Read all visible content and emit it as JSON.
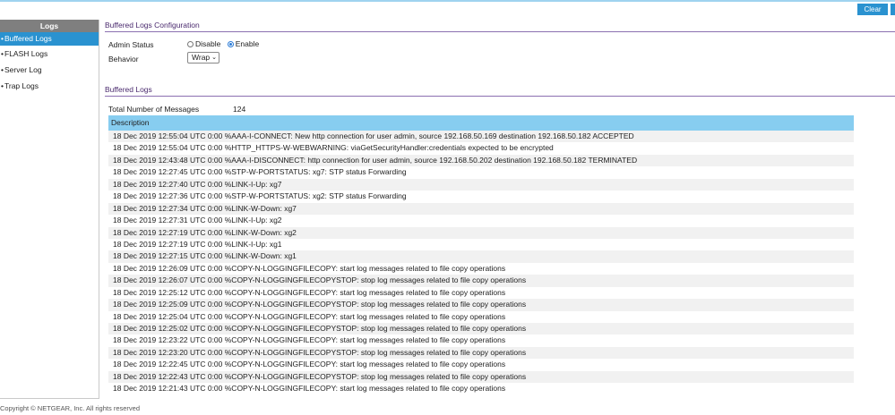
{
  "toolbar": {
    "clear_label": "Clear"
  },
  "sidebar": {
    "title": "Logs",
    "items": [
      {
        "label": "Buffered Logs",
        "active": true
      },
      {
        "label": "FLASH Logs",
        "active": false
      },
      {
        "label": "Server Log",
        "active": false
      },
      {
        "label": "Trap Logs",
        "active": false
      }
    ]
  },
  "config": {
    "title": "Buffered Logs Configuration",
    "admin_status_label": "Admin Status",
    "disable_label": "Disable",
    "enable_label": "Enable",
    "admin_status_value": "Enable",
    "behavior_label": "Behavior",
    "behavior_value": "Wrap"
  },
  "logs": {
    "title": "Buffered Logs",
    "total_label": "Total Number of Messages",
    "total_value": "124",
    "column_header": "Description",
    "rows": [
      "18 Dec 2019 12:55:04 UTC 0:00 %AAA-I-CONNECT: New http connection for user admin, source 192.168.50.169 destination 192.168.50.182 ACCEPTED",
      "18 Dec 2019 12:55:04 UTC 0:00 %HTTP_HTTPS-W-WEBWARNING: viaGetSecurityHandler:credentials expected to be encrypted",
      "18 Dec 2019 12:43:48 UTC 0:00 %AAA-I-DISCONNECT: http connection for user admin, source 192.168.50.202 destination 192.168.50.182 TERMINATED",
      "18 Dec 2019 12:27:45 UTC 0:00 %STP-W-PORTSTATUS: xg7: STP status Forwarding",
      "18 Dec 2019 12:27:40 UTC 0:00 %LINK-I-Up: xg7",
      "18 Dec 2019 12:27:36 UTC 0:00 %STP-W-PORTSTATUS: xg2: STP status Forwarding",
      "18 Dec 2019 12:27:34 UTC 0:00 %LINK-W-Down: xg7",
      "18 Dec 2019 12:27:31 UTC 0:00 %LINK-I-Up: xg2",
      "18 Dec 2019 12:27:19 UTC 0:00 %LINK-W-Down: xg2",
      "18 Dec 2019 12:27:19 UTC 0:00 %LINK-I-Up: xg1",
      "18 Dec 2019 12:27:15 UTC 0:00 %LINK-W-Down: xg1",
      "18 Dec 2019 12:26:09 UTC 0:00 %COPY-N-LOGGINGFILECOPY: start log messages related to file copy operations",
      "18 Dec 2019 12:26:07 UTC 0:00 %COPY-N-LOGGINGFILECOPYSTOP: stop log messages related to file copy operations",
      "18 Dec 2019 12:25:12 UTC 0:00 %COPY-N-LOGGINGFILECOPY: start log messages related to file copy operations",
      "18 Dec 2019 12:25:09 UTC 0:00 %COPY-N-LOGGINGFILECOPYSTOP: stop log messages related to file copy operations",
      "18 Dec 2019 12:25:04 UTC 0:00 %COPY-N-LOGGINGFILECOPY: start log messages related to file copy operations",
      "18 Dec 2019 12:25:02 UTC 0:00 %COPY-N-LOGGINGFILECOPYSTOP: stop log messages related to file copy operations",
      "18 Dec 2019 12:23:22 UTC 0:00 %COPY-N-LOGGINGFILECOPY: start log messages related to file copy operations",
      "18 Dec 2019 12:23:20 UTC 0:00 %COPY-N-LOGGINGFILECOPYSTOP: stop log messages related to file copy operations",
      "18 Dec 2019 12:22:45 UTC 0:00 %COPY-N-LOGGINGFILECOPY: start log messages related to file copy operations",
      "18 Dec 2019 12:22:43 UTC 0:00 %COPY-N-LOGGINGFILECOPYSTOP: stop log messages related to file copy operations",
      "18 Dec 2019 12:21:43 UTC 0:00 %COPY-N-LOGGINGFILECOPY: start log messages related to file copy operations"
    ]
  },
  "footer": {
    "copyright": "Copyright © NETGEAR, Inc. All rights reserved"
  },
  "colors": {
    "accent": "#2a92d0",
    "header_row": "#87cdf0",
    "section_title": "#4a2a6e"
  }
}
